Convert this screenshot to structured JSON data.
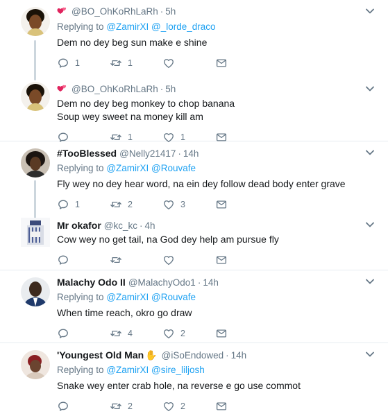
{
  "tweets": [
    {
      "name": "",
      "handle": "@BO_OhKoRhLaRh",
      "time": "5h",
      "replying_prefix": "Replying to",
      "mentions": [
        "@ZamirXI",
        "@_lorde_draco"
      ],
      "lines": [
        "Dem no dey beg sun make e shine"
      ],
      "replies": "1",
      "retweets": "1",
      "likes": ""
    },
    {
      "name": "",
      "handle": "@BO_OhKoRhLaRh",
      "time": "5h",
      "lines": [
        "Dem no dey beg monkey to chop banana",
        "Soup wey sweet na money kill am"
      ],
      "replies": "",
      "retweets": "1",
      "likes": "1"
    },
    {
      "name": "#TooBlessed",
      "handle": "@Nelly21417",
      "time": "14h",
      "replying_prefix": "Replying to",
      "mentions": [
        "@ZamirXI",
        "@Rouvafe"
      ],
      "lines": [
        "Fly wey no dey hear word, na ein dey follow dead body enter grave"
      ],
      "replies": "1",
      "retweets": "2",
      "likes": "3"
    },
    {
      "name": "Mr okafor",
      "handle": "@kc_kc",
      "time": "4h",
      "lines": [
        "Cow wey no get tail, na God dey help am pursue fly"
      ],
      "replies": "",
      "retweets": "",
      "likes": ""
    },
    {
      "name": "Malachy Odo II",
      "handle": "@MalachyOdo1",
      "time": "14h",
      "replying_prefix": "Replying to",
      "mentions": [
        "@ZamirXI",
        "@Rouvafe"
      ],
      "lines": [
        "When time reach, okro go draw"
      ],
      "replies": "",
      "retweets": "4",
      "likes": "2"
    },
    {
      "name": "'Youngest Old Man",
      "handle": "@iSoEndowed",
      "time": "14h",
      "replying_prefix": "Replying to",
      "mentions": [
        "@ZamirXI",
        "@sire_liljosh"
      ],
      "lines": [
        "Snake wey enter crab hole, na reverse e go use commot"
      ],
      "replies": "",
      "retweets": "2",
      "likes": "2"
    }
  ],
  "separator": "·",
  "icons": {
    "reply": "reply-icon",
    "retweet": "retweet-icon",
    "like": "heart-icon",
    "message": "envelope-icon",
    "caret": "chevron-down-icon",
    "name_emoji_1": "two-hearts-emoji",
    "name_emoji_6": "clapping-hands-emoji"
  },
  "colors": {
    "link": "#1da1f2",
    "secondary": "#657786",
    "divider": "#e6ecf0",
    "thread": "#ccd6dd",
    "emoji_hearts": "#e0245e"
  }
}
